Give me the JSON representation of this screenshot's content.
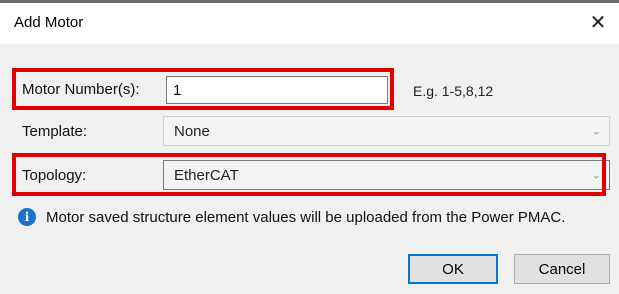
{
  "window": {
    "title": "Add Motor",
    "close_glyph": "✕"
  },
  "form": {
    "motor_numbers": {
      "label": "Motor Number(s):",
      "value": "1",
      "hint": "E.g. 1-5,8,12"
    },
    "template": {
      "label": "Template:",
      "value": "None"
    },
    "topology": {
      "label": "Topology:",
      "value": "EtherCAT"
    }
  },
  "info": {
    "icon": "info-icon",
    "text": "Motor saved structure element values will be uploaded from the Power PMAC."
  },
  "buttons": {
    "ok": "OK",
    "cancel": "Cancel"
  },
  "colors": {
    "highlight": "#e00000",
    "info": "#1a73c9",
    "primary_border": "#0078d7"
  }
}
